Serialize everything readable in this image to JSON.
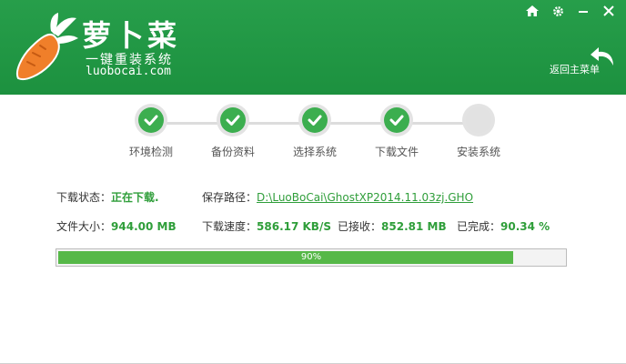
{
  "logo": {
    "title": "萝卜菜",
    "subtitle": "一键重装系统",
    "url": "luobocai.com"
  },
  "window_buttons": [
    "home-icon",
    "gear-icon",
    "minimize-icon",
    "close-icon"
  ],
  "back_button": {
    "label": "返回主菜单",
    "icon": "back-arrow-icon"
  },
  "steps": [
    {
      "label": "环境检测",
      "status": "done"
    },
    {
      "label": "备份资料",
      "status": "done"
    },
    {
      "label": "选择系统",
      "status": "done"
    },
    {
      "label": "下载文件",
      "status": "done"
    },
    {
      "label": "安装系统",
      "status": "pending"
    }
  ],
  "download": {
    "status_label": "下载状态：",
    "status_value": "正在下载.",
    "path_label": "保存路径：",
    "path_value": "D:\\LuoBoCai\\GhostXP2014.11.03zj.GHO",
    "size_label": "文件大小：",
    "size_value": "944.00 MB",
    "speed_label": "下载速度：",
    "speed_value": "586.17 KB/S",
    "received_label": "已接收：",
    "received_value": "852.81 MB",
    "completed_label": "已完成：",
    "completed_value": "90.34 %"
  },
  "progress": {
    "fraction": 0.9,
    "text": "90%"
  },
  "colors": {
    "brand_green": "#1e9a43",
    "accent_green": "#2f9e3a",
    "progress_fill": "#56b848"
  }
}
